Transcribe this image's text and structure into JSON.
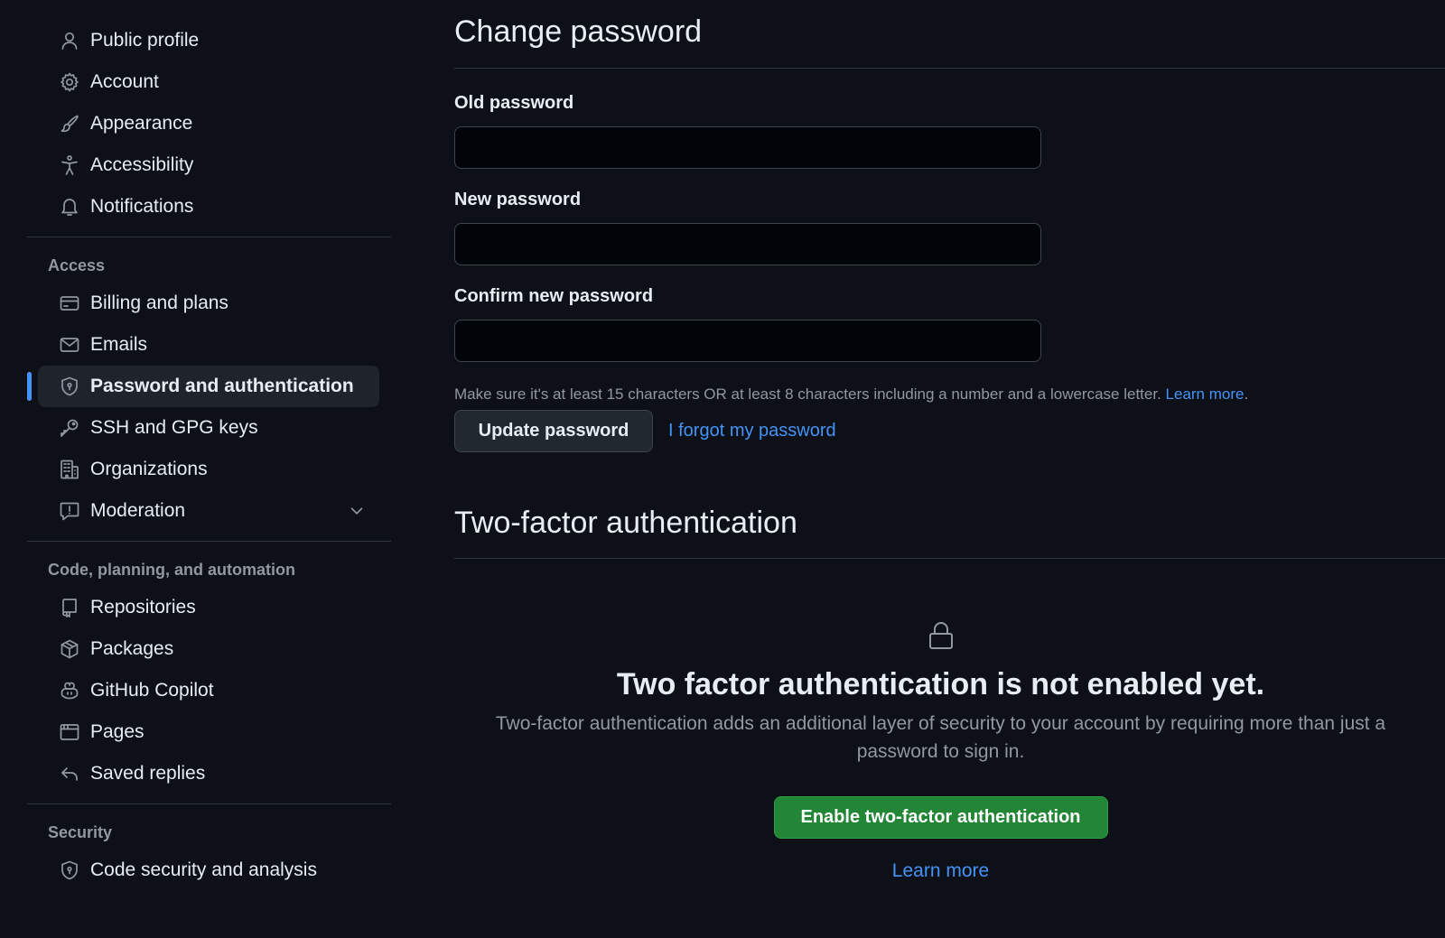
{
  "sidebar": {
    "personal_items": [
      {
        "label": "Public profile",
        "icon": "person-icon"
      },
      {
        "label": "Account",
        "icon": "gear-icon"
      },
      {
        "label": "Appearance",
        "icon": "paintbrush-icon"
      },
      {
        "label": "Accessibility",
        "icon": "accessibility-icon"
      },
      {
        "label": "Notifications",
        "icon": "bell-icon"
      }
    ],
    "access": {
      "heading": "Access",
      "items": [
        {
          "label": "Billing and plans",
          "icon": "credit-card-icon"
        },
        {
          "label": "Emails",
          "icon": "mail-icon"
        },
        {
          "label": "Password and authentication",
          "icon": "shield-lock-icon",
          "selected": true
        },
        {
          "label": "SSH and GPG keys",
          "icon": "key-icon"
        },
        {
          "label": "Organizations",
          "icon": "organization-icon"
        },
        {
          "label": "Moderation",
          "icon": "report-icon",
          "expandable": true
        }
      ]
    },
    "code": {
      "heading": "Code, planning, and automation",
      "items": [
        {
          "label": "Repositories",
          "icon": "repo-icon"
        },
        {
          "label": "Packages",
          "icon": "package-icon"
        },
        {
          "label": "GitHub Copilot",
          "icon": "copilot-icon"
        },
        {
          "label": "Pages",
          "icon": "browser-icon"
        },
        {
          "label": "Saved replies",
          "icon": "reply-icon"
        }
      ]
    },
    "security": {
      "heading": "Security",
      "items": [
        {
          "label": "Code security and analysis",
          "icon": "shield-lock-icon"
        }
      ]
    }
  },
  "change_password": {
    "title": "Change password",
    "old_label": "Old password",
    "new_label": "New password",
    "confirm_label": "Confirm new password",
    "old_value": "",
    "new_value": "",
    "confirm_value": "",
    "hint": "Make sure it's at least 15 characters OR at least 8 characters including a number and a lowercase letter.",
    "hint_link": "Learn more",
    "hint_period": ".",
    "update_button": "Update password",
    "forgot_link": "I forgot my password"
  },
  "two_factor": {
    "title": "Two-factor authentication",
    "blank_title": "Two factor authentication is not enabled yet.",
    "blank_desc": "Two-factor authentication adds an additional layer of security to your account by requiring more than just a password to sign in.",
    "enable_button": "Enable two-factor authentication",
    "learn_more": "Learn more"
  },
  "colors": {
    "background": "#0d1117",
    "accent": "#4493f8",
    "success_button": "#238636",
    "muted_text": "#9198a1"
  }
}
